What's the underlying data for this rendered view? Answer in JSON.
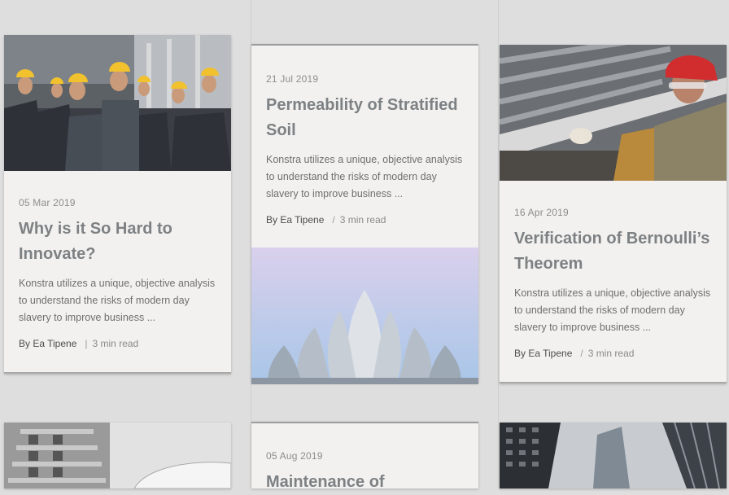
{
  "posts": [
    {
      "date": "05 Mar 2019",
      "title": "Why is it So Hard to Innovate?",
      "excerpt": "Konstra utilizes a unique, objective analysis to understand the risks of modern day slavery to improve business ...",
      "author": "By Ea Tipene",
      "separator": "|",
      "read_time": "3 min read",
      "image": "construction-workers-photo"
    },
    {
      "date": "21 Jul 2019",
      "title": "Permeability of Stratified Soil",
      "excerpt": "Konstra utilizes a unique, objective analysis to understand the risks of modern day slavery to improve business ...",
      "author": "By Ea Tipene",
      "separator": "/",
      "read_time": "3 min read",
      "image": "lotus-temple-photo"
    },
    {
      "date": "16 Apr 2019",
      "title": "Verification of Bernoulli’s Theorem",
      "excerpt": "Konstra utilizes a unique, objective analysis to understand the risks of modern day slavery to improve business ...",
      "author": "By Ea Tipene",
      "separator": "/",
      "read_time": "3 min read",
      "image": "worker-red-cap-photo"
    },
    {
      "date": "05 Aug 2019",
      "title": "Maintenance of",
      "image": "none"
    }
  ],
  "colors": {
    "background": "#dedede",
    "card": "#f2f1ef",
    "title": "#7d8184",
    "text": "#6f6f6f"
  }
}
